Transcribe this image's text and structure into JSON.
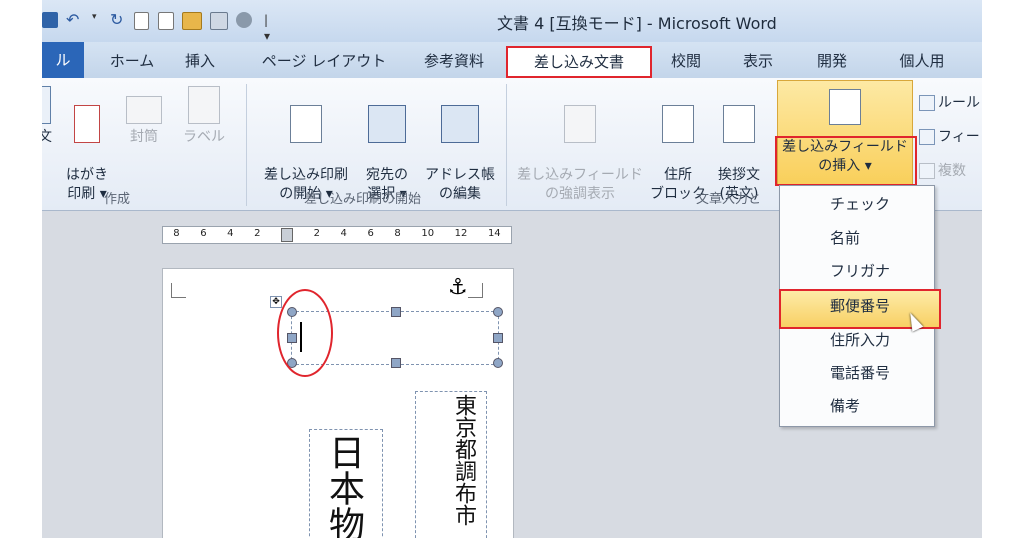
{
  "titlebar": {
    "title": "文書 4 [互換モード] - Microsoft Word",
    "qat_icons": [
      "save-icon",
      "undo-icon",
      "redo-icon",
      "new-doc-icon",
      "print-preview-icon",
      "open-folder-icon",
      "copy-icon",
      "paint-icon",
      "customize-icon"
    ]
  },
  "tabs": [
    {
      "id": "file",
      "label": "ル"
    },
    {
      "id": "home",
      "label": "ホーム"
    },
    {
      "id": "insert",
      "label": "挿入"
    },
    {
      "id": "page-layout",
      "label": "ページ レイアウト"
    },
    {
      "id": "references",
      "label": "参考資料"
    },
    {
      "id": "mailings",
      "label": "差し込み文書",
      "active": true
    },
    {
      "id": "review",
      "label": "校閲"
    },
    {
      "id": "view",
      "label": "表示"
    },
    {
      "id": "developer",
      "label": "開発"
    },
    {
      "id": "personal",
      "label": "個人用"
    }
  ],
  "ribbon": {
    "create": {
      "label": "作成",
      "envelopes_partial": "文",
      "postcard": "はがき\n印刷 ▾",
      "envelope": "封筒",
      "labels": "ラベル"
    },
    "start_merge": {
      "label": "差し込み印刷の開始",
      "start": "差し込み印刷\nの開始 ▾",
      "recipients": "宛先の\n選択 ▾",
      "edit_list": "アドレス帳\nの編集"
    },
    "write_insert": {
      "label": "文章入力と",
      "highlight": "差し込みフィールド\nの強調表示",
      "address_block": "住所\nブロック",
      "greeting": "挨拶文\n(英文)",
      "insert_field": "差し込みフィールド\nの挿入 ▾",
      "rules": "ルール",
      "match_fields": "フィー",
      "update_labels": "複数"
    }
  },
  "ruler": {
    "ticks": [
      "8",
      "6",
      "4",
      "2",
      "",
      "2",
      "4",
      "6",
      "8",
      "10",
      "12",
      "",
      "14"
    ]
  },
  "document": {
    "anchor": "⚓",
    "text_right": "東京都調布市",
    "text_middle": "日本物"
  },
  "dropdown": {
    "items": [
      "チェック",
      "名前",
      "フリガナ",
      "郵便番号",
      "住所入力",
      "電話番号",
      "備考"
    ],
    "selected_index": 3
  }
}
